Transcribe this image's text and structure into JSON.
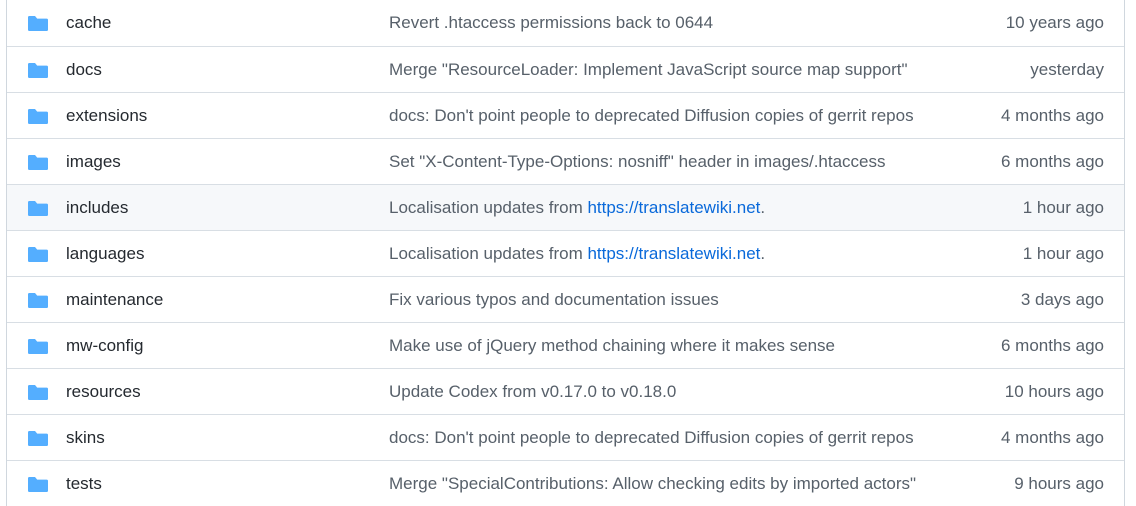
{
  "colors": {
    "folder": "#54aeff",
    "link": "#0969da",
    "text": "#24292f",
    "muted": "#57606a",
    "border": "#d8dee4",
    "hover_row": "#f6f8fa"
  },
  "files": [
    {
      "name": "cache",
      "icon": "folder-icon",
      "message": "Revert .htaccess permissions back to 0644",
      "link": "",
      "message_suffix": "",
      "age": "10 years ago"
    },
    {
      "name": "docs",
      "icon": "folder-icon",
      "message": "Merge \"ResourceLoader: Implement JavaScript source map support\"",
      "link": "",
      "message_suffix": "",
      "age": "yesterday"
    },
    {
      "name": "extensions",
      "icon": "folder-icon",
      "message": "docs: Don't point people to deprecated Diffusion copies of gerrit repos",
      "link": "",
      "message_suffix": "",
      "age": "4 months ago"
    },
    {
      "name": "images",
      "icon": "folder-icon",
      "message": "Set \"X-Content-Type-Options: nosniff\" header in images/.htaccess",
      "link": "",
      "message_suffix": "",
      "age": "6 months ago"
    },
    {
      "name": "includes",
      "icon": "folder-icon",
      "message": "Localisation updates from ",
      "link": "https://translatewiki.net",
      "message_suffix": ".",
      "age": "1 hour ago"
    },
    {
      "name": "languages",
      "icon": "folder-icon",
      "message": "Localisation updates from ",
      "link": "https://translatewiki.net",
      "message_suffix": ".",
      "age": "1 hour ago"
    },
    {
      "name": "maintenance",
      "icon": "folder-icon",
      "message": "Fix various typos and documentation issues",
      "link": "",
      "message_suffix": "",
      "age": "3 days ago"
    },
    {
      "name": "mw-config",
      "icon": "folder-icon",
      "message": "Make use of jQuery method chaining where it makes sense",
      "link": "",
      "message_suffix": "",
      "age": "6 months ago"
    },
    {
      "name": "resources",
      "icon": "folder-icon",
      "message": "Update Codex from v0.17.0 to v0.18.0",
      "link": "",
      "message_suffix": "",
      "age": "10 hours ago"
    },
    {
      "name": "skins",
      "icon": "folder-icon",
      "message": "docs: Don't point people to deprecated Diffusion copies of gerrit repos",
      "link": "",
      "message_suffix": "",
      "age": "4 months ago"
    },
    {
      "name": "tests",
      "icon": "folder-icon",
      "message": "Merge \"SpecialContributions: Allow checking edits by imported actors\"",
      "link": "",
      "message_suffix": "",
      "age": "9 hours ago"
    }
  ]
}
